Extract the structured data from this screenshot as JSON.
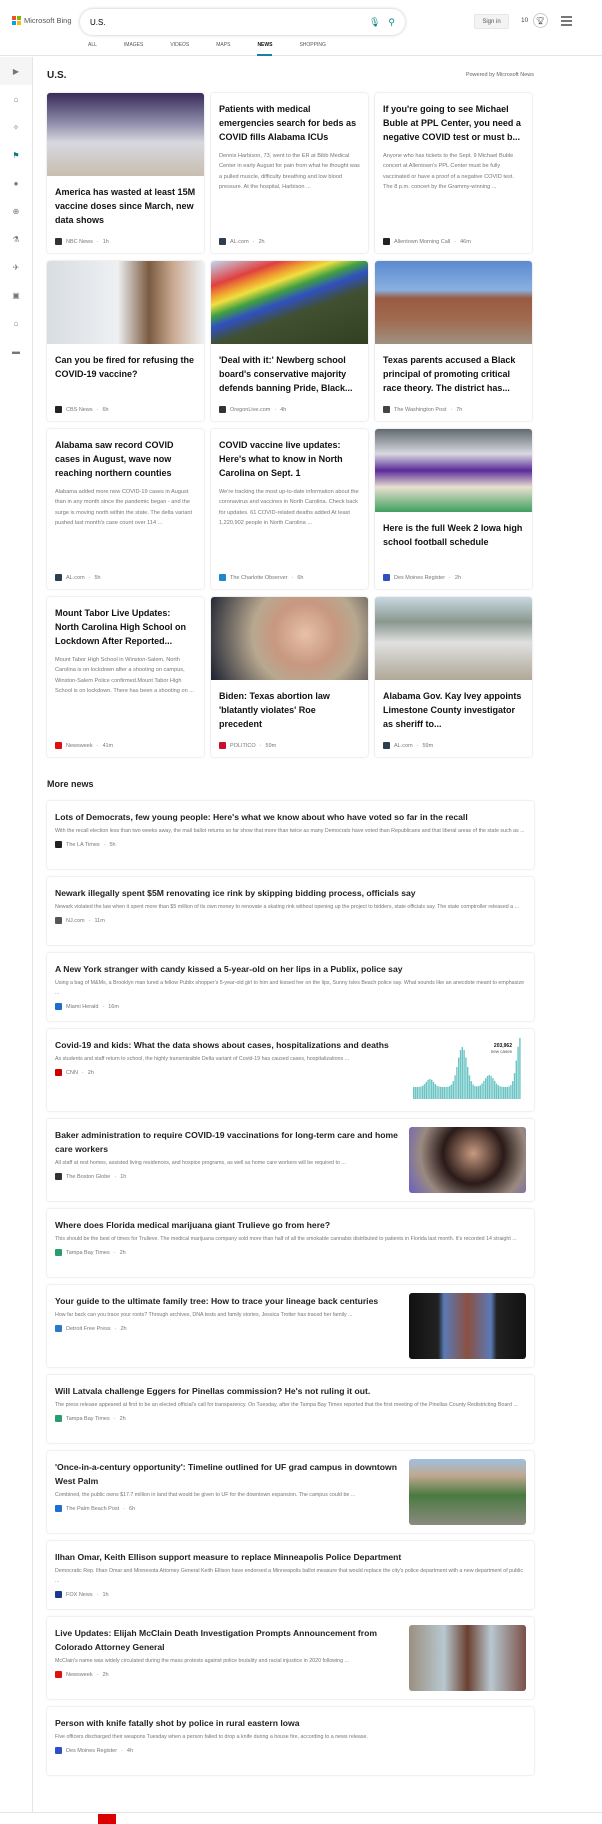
{
  "header": {
    "brand": "Microsoft Bing",
    "query": "U.S.",
    "sign_in": "Sign in",
    "points": "10"
  },
  "tabs": [
    "ALL",
    "IMAGES",
    "VIDEOS",
    "MAPS",
    "NEWS",
    "SHOPPING"
  ],
  "active_tab": "NEWS",
  "sidebar": [
    "expand",
    "home",
    "science",
    "us",
    "local",
    "world",
    "science-lab",
    "technology",
    "entertainment",
    "politics",
    "money"
  ],
  "section": {
    "title": "U.S.",
    "powered_by": "Powered by Microsoft News"
  },
  "cards": [
    {
      "title": "America has wasted at least 15M vaccine doses since March, new data shows",
      "desc": "",
      "source": "NBC News",
      "time": "1h",
      "image": "vaccine-vials",
      "icon_color": "#333"
    },
    {
      "title": "Patients with medical emergencies search for beds as COVID fills Alabama ICUs",
      "desc": "Dennis Harbison, 73, went to the ER at Bibb Medical Center in early August for pain from what he thought was a pulled muscle, difficulty breathing and low blood pressure. At the hospital, Harbison ...",
      "source": "AL.com",
      "time": "2h",
      "image": "",
      "icon_color": "#2c3e50"
    },
    {
      "title": "If you're going to see Michael Buble at PPL Center, you need a negative COVID test or must b...",
      "desc": "Anyone who has tickets to the Sept. 9 Michael Buble concert at Allentown's PPL Center must be fully vaccinated or have a proof of a negative COVID test. The 8 p.m. concert by the Grammy-winning ...",
      "source": "Allentown Morning Call",
      "time": "46m",
      "image": "",
      "icon_color": "#222"
    },
    {
      "title": "Can you be fired for refusing the COVID-19 vaccine?",
      "desc": "",
      "source": "CBS News",
      "time": "6h",
      "image": "masked-woman",
      "icon_color": "#222"
    },
    {
      "title": "'Deal with it:' Newberg school board's conservative majority defends banning Pride, Black...",
      "desc": "",
      "source": "OregonLive.com",
      "time": "4h",
      "image": "pride-flag",
      "icon_color": "#333"
    },
    {
      "title": "Texas parents accused a Black principal of promoting critical race theory. The district has...",
      "desc": "",
      "source": "The Washington Post",
      "time": "7h",
      "image": "school-building",
      "icon_color": "#444"
    },
    {
      "title": "Alabama saw record COVID cases in August, wave now reaching northern counties",
      "desc": "Alabama added more new COVID-19 cases in August than in any month since the pandemic began - and the surge is moving north within the state. The delta variant pushed last month's case count over 114 ...",
      "source": "AL.com",
      "time": "5h",
      "image": "",
      "icon_color": "#2c3e50"
    },
    {
      "title": "COVID vaccine live updates: Here's what to know in North Carolina on Sept. 1",
      "desc": "We're tracking the most up-to-date information about the coronavirus and vaccines in North Carolina. Check back for updates. 61 COVID-related deaths added At least 1,220,902 people in North Carolina ...",
      "source": "The Charlotte Observer",
      "time": "6h",
      "image": "",
      "icon_color": "#1e88c8"
    },
    {
      "title": "Here is the full Week 2 Iowa high school football schedule",
      "desc": "",
      "source": "Des Moines Register",
      "time": "2h",
      "image": "football",
      "icon_color": "#3050c0"
    },
    {
      "title": "Mount Tabor Live Updates: North Carolina High School on Lockdown After Reported...",
      "desc": "Mount Tabor High School in Winston-Salem, North Carolina is on lockdown after a shooting on campus, Winston-Salem Police confirmed.Mount Tabor High School is on lockdown. There has been a shooting on ...",
      "source": "Newsweek",
      "time": "41m",
      "image": "",
      "icon_color": "#e01010"
    },
    {
      "title": "Biden: Texas abortion law 'blatantly violates' Roe precedent",
      "desc": "",
      "source": "POLITICO",
      "time": "59m",
      "image": "biden",
      "icon_color": "#c8102e"
    },
    {
      "title": "Alabama Gov. Kay Ivey appoints Limestone County investigator as sheriff to...",
      "desc": "",
      "source": "AL.com",
      "time": "59m",
      "image": "street",
      "icon_color": "#2c3e50"
    }
  ],
  "more_news_title": "More news",
  "more_news": [
    {
      "title": "Lots of Democrats, few young people: Here's what we know about who have voted so far in the recall",
      "desc": "With the recall election less than two weeks away, the mail ballot returns so far show that more than twice as many Democrats have voted than Republicans and that liberal areas of the state such as ...",
      "source": "The LA Times",
      "time": "5h",
      "image": "",
      "icon_color": "#222"
    },
    {
      "title": "Newark illegally spent $5M renovating ice rink by skipping bidding process, officials say",
      "desc": "Newark violated the law when it spent more than $5 million of its own money to renovate a skating rink without opening up the project to bidders, state officials say. The state comptroller released a ...",
      "source": "NJ.com",
      "time": "11m",
      "image": "",
      "icon_color": "#555"
    },
    {
      "title": "A New York stranger with candy kissed a 5-year-old on her lips in a Publix, police say",
      "desc": "Using a bag of M&Ms, a Brooklyn man lured a fellow Publix shopper's 5-year-old girl to him and kissed her on the lips, Sunny Isles Beach police say. What sounds like an anecdote meant to emphasize ...",
      "source": "Miami Herald",
      "time": "16m",
      "image": "",
      "icon_color": "#1e6fc8"
    },
    {
      "title": "Covid-19 and kids: What the data shows about cases, hospitalizations and deaths",
      "desc": "As students and staff return to school, the highly transmissible Delta variant of Covid-19 has caused cases, hospitalizations ...",
      "source": "CNN",
      "time": "2h",
      "image": "chart",
      "icon_color": "#cc0000",
      "chart_label": "203,962",
      "chart_sublabel": "new cases"
    },
    {
      "title": "Baker administration to require COVID-19 vaccinations for long-term care and home care workers",
      "desc": "All staff at rest homes, assisted living residences, and hospice programs, as well as home care workers will be required to ...",
      "source": "The Boston Globe",
      "time": "1h",
      "image": "nurse",
      "icon_color": "#333"
    },
    {
      "title": "Where does Florida medical marijuana giant Trulieve go from here?",
      "desc": "This should be the best of times for Trulieve. The medical marijuana company sold more than half of all the smokable cannabis distributed to patients in Florida last month. It's recorded 14 straight ...",
      "source": "Tampa Bay Times",
      "time": "2h",
      "image": "",
      "icon_color": "#2a9d6f"
    },
    {
      "title": "Your guide to the ultimate family tree: How to trace your lineage back centuries",
      "desc": "How far back can you trace your roots? Through archives, DNA tests and family stories, Jessica Trotter has traced her family ...",
      "source": "Detroit Free Press",
      "time": "2h",
      "image": "building",
      "icon_color": "#2a7ac8"
    },
    {
      "title": "Will Latvala challenge Eggers for Pinellas commission? He's not ruling it out.",
      "desc": "The press release appeared at first to be an elected official's call for transparency. On Tuesday, after the Tampa Bay Times reported that the first meeting of the Pinellas County Redistricting Board ...",
      "source": "Tampa Bay Times",
      "time": "2h",
      "image": "",
      "icon_color": "#2a9d6f"
    },
    {
      "title": "'Once-in-a-century opportunity': Timeline outlined for UF grad campus in downtown West Palm",
      "desc": "Combined, the public owns $17.7 million in land that would be given to UF for the downtown expansion. The campus could be ...",
      "source": "The Palm Beach Post",
      "time": "6h",
      "image": "city",
      "icon_color": "#1f6fd0"
    },
    {
      "title": "Ilhan Omar, Keith Ellison support measure to replace Minneapolis Police Department",
      "desc": "Democratic Rep. Ilhan Omar and Minnesota Attorney General Keith Ellison have endorsed a Minneapolis ballot measure that would replace the city's police department with a new department of public ...",
      "source": "FOX News",
      "time": "1h",
      "image": "",
      "icon_color": "#1a3a8a"
    },
    {
      "title": "Live Updates: Elijah McClain Death Investigation Prompts Announcement from Colorado Attorney General",
      "desc": "McClain's name was widely circulated during the mass protests against police brutality and racial injustice in 2020 following ...",
      "source": "Newsweek",
      "time": "2h",
      "image": "protest",
      "icon_color": "#e01010"
    },
    {
      "title": "Person with knife fatally shot by police in rural eastern Iowa",
      "desc": "Five officers discharged their weapons Tuesday when a person failed to drop a knife during a house fire, according to a news release.",
      "source": "Des Moines Register",
      "time": "4h",
      "image": "",
      "icon_color": "#3050c0"
    }
  ],
  "colors": {
    "accent": "#0c8484",
    "tab_underline": "#1a7fa0"
  }
}
